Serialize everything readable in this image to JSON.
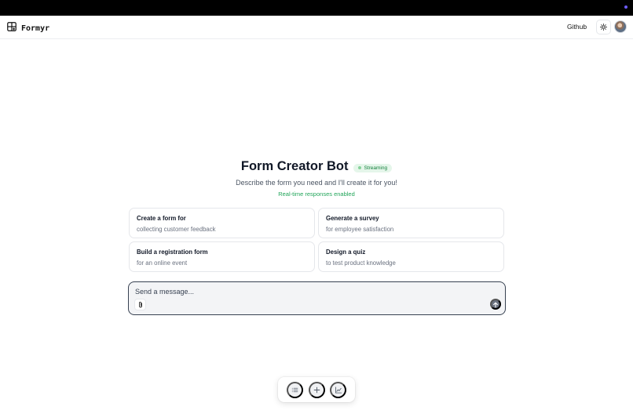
{
  "header": {
    "brand": "Formyr",
    "brand_icon": "grid-plus-icon",
    "github_label": "Github",
    "theme_icon": "sun-icon",
    "avatar_icon": "user-avatar"
  },
  "hero": {
    "title": "Form Creator Bot",
    "badge": "Streaming",
    "subtitle": "Describe the form you need and I'll create it for you!",
    "streaming_note": "Real-time responses enabled"
  },
  "suggestions": [
    {
      "title": "Create a form for",
      "subtitle": "collecting customer feedback"
    },
    {
      "title": "Generate a survey",
      "subtitle": "for employee satisfaction"
    },
    {
      "title": "Build a registration form",
      "subtitle": "for an online event"
    },
    {
      "title": "Design a quiz",
      "subtitle": "to test product knowledge"
    }
  ],
  "composer": {
    "placeholder": "Send a message...",
    "value": "",
    "attach_icon": "paperclip-icon",
    "send_icon": "arrow-up-icon"
  },
  "dock": {
    "items": [
      "list-icon",
      "plus-icon",
      "chart-icon"
    ]
  },
  "colors": {
    "accent_green": "#22a55a",
    "badge_bg": "#e5f6ea",
    "send_button": "#6b7280"
  }
}
